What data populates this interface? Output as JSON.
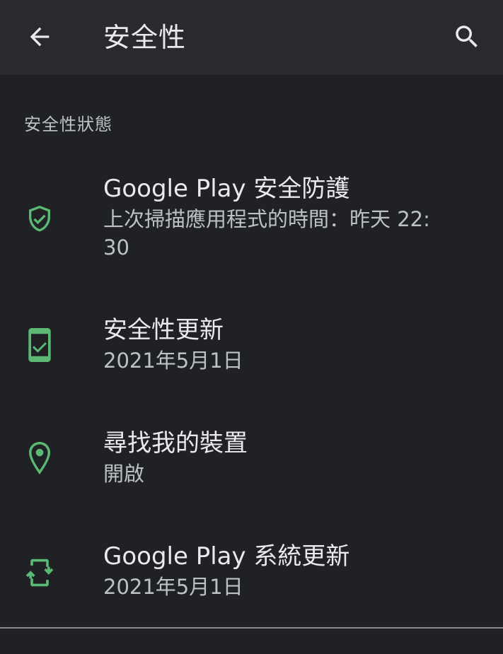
{
  "appbar": {
    "title": "安全性",
    "back_icon": "arrow-back-icon",
    "search_icon": "search-icon"
  },
  "section": {
    "header": "安全性狀態"
  },
  "items": [
    {
      "icon": "shield-check-icon",
      "title": "Google Play 安全防護",
      "subtitle": "上次掃描應用程式的時間：昨天 22:30"
    },
    {
      "icon": "phone-check-icon",
      "title": "安全性更新",
      "subtitle": "2021年5月1日"
    },
    {
      "icon": "location-pin-icon",
      "title": "尋找我的裝置",
      "subtitle": "開啟"
    },
    {
      "icon": "system-update-icon",
      "title": "Google Play 系統更新",
      "subtitle": "2021年5月1日"
    }
  ],
  "colors": {
    "background": "#202124",
    "appbar": "#292a2d",
    "accent_green": "#5bb974",
    "text_primary": "#e8eaed",
    "text_secondary": "#bdc1c6"
  }
}
